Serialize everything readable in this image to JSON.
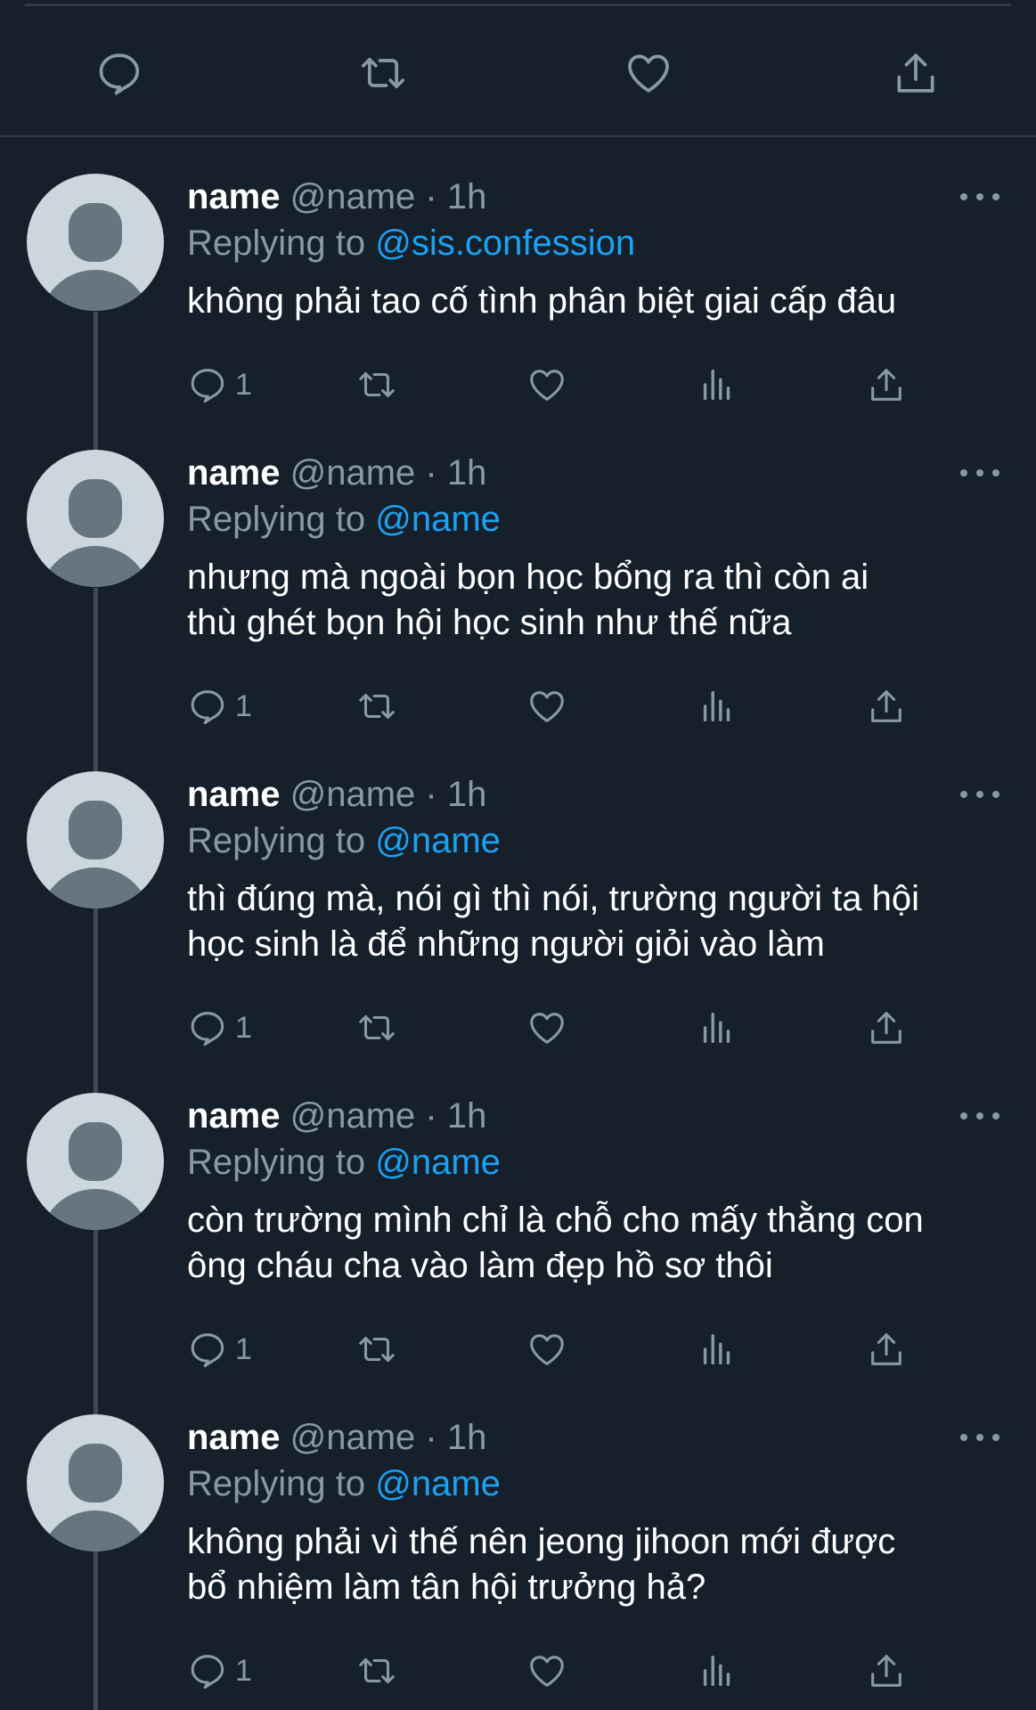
{
  "top_actions": [
    {
      "name": "reply",
      "icon": "reply-icon"
    },
    {
      "name": "retweet",
      "icon": "retweet-icon"
    },
    {
      "name": "like",
      "icon": "heart-icon"
    },
    {
      "name": "share",
      "icon": "share-icon"
    }
  ],
  "colors": {
    "background": "#15202b",
    "accent": "#1da1f2",
    "muted": "#8899a6",
    "divider": "#2f3b47"
  },
  "tweets": [
    {
      "display_name": "name",
      "handle": "@name",
      "separator": "·",
      "time": "1h",
      "reply_prefix": "Replying to",
      "reply_to": "@sis.confession",
      "lines": [
        "không phải tao cố tình phân biệt giai cấp đâu"
      ],
      "reply_count": "1"
    },
    {
      "display_name": "name",
      "handle": "@name",
      "separator": "·",
      "time": "1h",
      "reply_prefix": "Replying to",
      "reply_to": "@name",
      "lines": [
        "nhưng mà ngoài bọn học bổng ra thì còn ai",
        "thù ghét bọn hội học sinh như thế nữa"
      ],
      "reply_count": "1"
    },
    {
      "display_name": "name",
      "handle": "@name",
      "separator": "·",
      "time": "1h",
      "reply_prefix": "Replying to",
      "reply_to": "@name",
      "lines": [
        "thì đúng mà, nói gì thì nói, trường người ta hội",
        "học sinh là để những người giỏi vào làm"
      ],
      "reply_count": "1"
    },
    {
      "display_name": "name",
      "handle": "@name",
      "separator": "·",
      "time": "1h",
      "reply_prefix": "Replying to",
      "reply_to": "@name",
      "lines": [
        "còn trường mình chỉ là chỗ cho mấy thằng con",
        "ông cháu cha vào làm đẹp hồ sơ thôi"
      ],
      "reply_count": "1"
    },
    {
      "display_name": "name",
      "handle": "@name",
      "separator": "·",
      "time": "1h",
      "reply_prefix": "Replying to",
      "reply_to": "@name",
      "lines": [
        "không phải vì thế nên jeong jihoon mới được",
        "bổ nhiệm làm tân hội trưởng hả?"
      ],
      "reply_count": "1"
    }
  ]
}
